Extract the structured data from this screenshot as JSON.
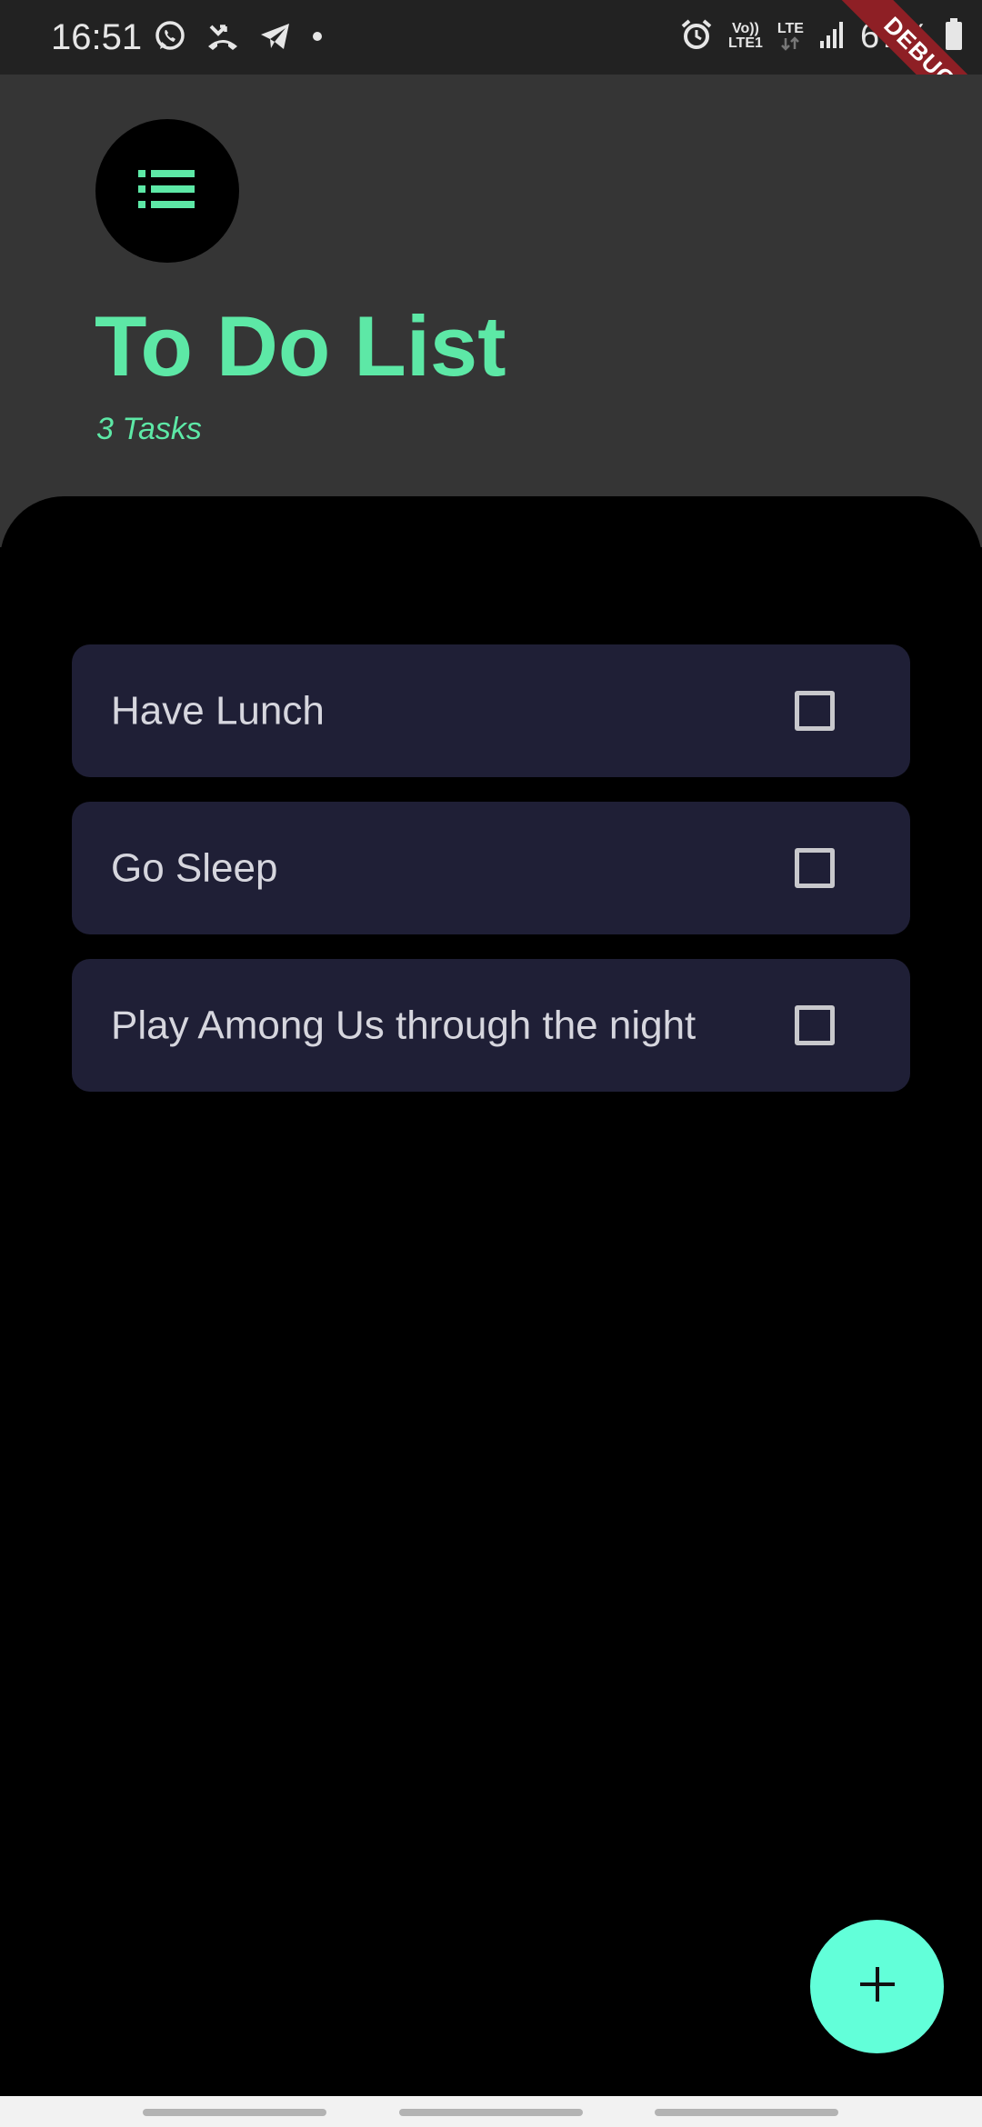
{
  "status_bar": {
    "time": "16:51",
    "left_icons": [
      "whatsapp-icon",
      "missed-call-icon",
      "telegram-icon",
      "dot-icon"
    ],
    "volte_top": "Vo))",
    "volte_bottom": "LTE1",
    "lte_label": "LTE",
    "battery_percent": "67%",
    "debug_label": "DEBUG"
  },
  "header": {
    "menu_icon": "list-icon",
    "title": "To Do List",
    "task_count": "3 Tasks"
  },
  "tasks": [
    {
      "label": "Have Lunch",
      "checked": false
    },
    {
      "label": "Go Sleep",
      "checked": false
    },
    {
      "label": "Play Among Us through the night",
      "checked": false
    }
  ],
  "fab": {
    "icon": "plus-icon"
  },
  "colors": {
    "accent": "#5de8a6",
    "fab": "#62ffd9",
    "card": "#1f1f36",
    "header_bg": "#353535",
    "panel_bg": "#000000"
  }
}
